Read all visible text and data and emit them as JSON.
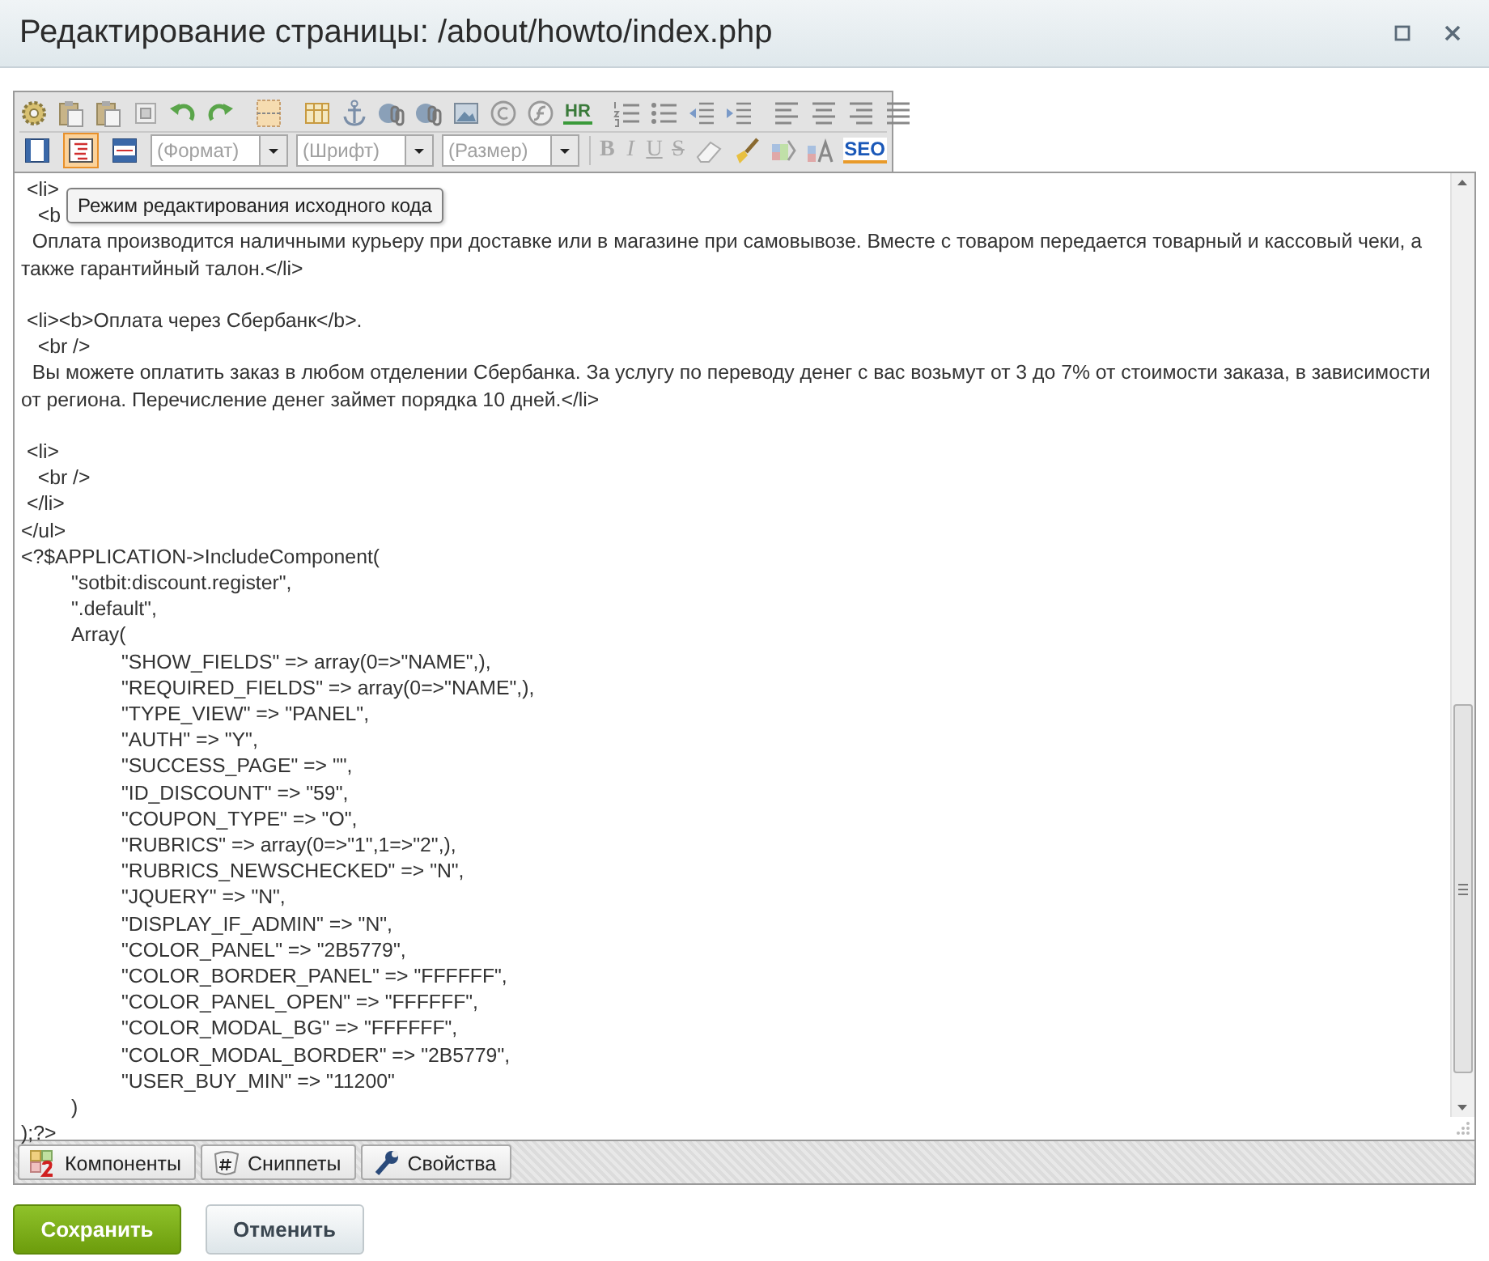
{
  "window": {
    "title": "Редактирование страницы: /about/howto/index.php"
  },
  "toolbar": {
    "hr_label": "HR",
    "view_modes": [
      {
        "selected": false
      },
      {
        "selected": true
      },
      {
        "selected": false
      }
    ],
    "dropdowns": [
      {
        "placeholder": "(Формат)"
      },
      {
        "placeholder": "(Шрифт)"
      },
      {
        "placeholder": "(Размер)"
      }
    ],
    "format_buttons": [
      "B",
      "I",
      "U",
      "S"
    ],
    "seo_label": "SEO"
  },
  "tooltip": "Режим редактирования исходного кода",
  "code_blocks": [
    {
      "lines": [
        " <li>",
        "   <b",
        "  Оплата производится наличными курьеру при доставке или в магазине при самовывозе. Вместе с товаром передается товарный и кассовый чеки, а также гарантийный талон.</li>"
      ]
    },
    {
      "lines": [
        " <li><b>Оплата через Сбербанк</b>.",
        "   <br />",
        "  Вы можете оплатить заказ в любом отделении Сбербанка. За услугу по переводу денег с вас возьмут от 3 до 7% от стоимости заказа, в зависимости от региона. Перечисление денег займет порядка 10 дней.</li>"
      ]
    },
    {
      "lines": [
        " <li>",
        "   <br />",
        " </li>",
        "</ul>",
        "<?$APPLICATION->IncludeComponent(",
        "\t\"sotbit:discount.register\",",
        "\t\".default\",",
        "\tArray(",
        "\t\t\"SHOW_FIELDS\" => array(0=>\"NAME\",),",
        "\t\t\"REQUIRED_FIELDS\" => array(0=>\"NAME\",),",
        "\t\t\"TYPE_VIEW\" => \"PANEL\",",
        "\t\t\"AUTH\" => \"Y\",",
        "\t\t\"SUCCESS_PAGE\" => \"\",",
        "\t\t\"ID_DISCOUNT\" => \"59\",",
        "\t\t\"COUPON_TYPE\" => \"O\",",
        "\t\t\"RUBRICS\" => array(0=>\"1\",1=>\"2\",),",
        "\t\t\"RUBRICS_NEWSCHECKED\" => \"N\",",
        "\t\t\"JQUERY\" => \"N\",",
        "\t\t\"DISPLAY_IF_ADMIN\" => \"N\",",
        "\t\t\"COLOR_PANEL\" => \"2B5779\",",
        "\t\t\"COLOR_BORDER_PANEL\" => \"FFFFFF\",",
        "\t\t\"COLOR_PANEL_OPEN\" => \"FFFFFF\",",
        "\t\t\"COLOR_MODAL_BG\" => \"FFFFFF\",",
        "\t\t\"COLOR_MODAL_BORDER\" => \"2B5779\",",
        "\t\t\"USER_BUY_MIN\" => \"11200\"",
        "\t)",
        ");?>"
      ]
    }
  ],
  "bottom_tabs": [
    {
      "label": "Компоненты"
    },
    {
      "label": "Сниппеты"
    },
    {
      "label": "Свойства"
    }
  ],
  "buttons": [
    {
      "label": "Сохранить",
      "kind": "primary"
    },
    {
      "label": "Отменить",
      "kind": "secondary"
    }
  ]
}
